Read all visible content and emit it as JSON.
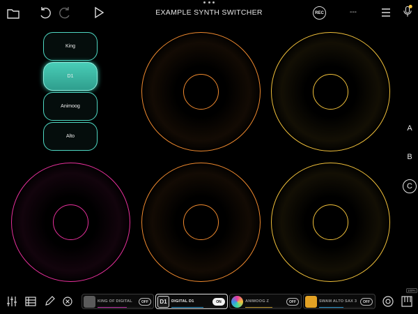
{
  "header": {
    "title": "EXAMPLE SYNTH SWITCHER",
    "rec_label": "REC",
    "status_text": "---",
    "icons": [
      "folder-icon",
      "undo-icon",
      "redo-icon",
      "play-icon",
      "menu-icon",
      "microphone-icon"
    ]
  },
  "presets": [
    {
      "label": "King",
      "active": false
    },
    {
      "label": "D1",
      "active": true
    },
    {
      "label": "Animoog",
      "active": false
    },
    {
      "label": "Alto",
      "active": false
    }
  ],
  "scenes": [
    {
      "label": "A",
      "selected": false
    },
    {
      "label": "B",
      "selected": false
    },
    {
      "label": "C",
      "selected": true
    }
  ],
  "pads": [
    {
      "name": "pad-top-middle",
      "color": "#f08a2e"
    },
    {
      "name": "pad-top-right",
      "color": "#f2c13a"
    },
    {
      "name": "pad-bottom-left",
      "color": "#e8309c"
    },
    {
      "name": "pad-bottom-middle",
      "color": "#f08a2e"
    },
    {
      "name": "pad-bottom-right",
      "color": "#f2c13a"
    }
  ],
  "synth_slots": [
    {
      "name": "KING OF DIGITAL",
      "toggle": "OFF",
      "active": false,
      "thumb": "#5a5a5a",
      "meter_color": "#c63bb0",
      "level": 0.55
    },
    {
      "name": "DIGITAL D1",
      "toggle": "ON",
      "active": true,
      "thumb": "#1a1a1a",
      "meter_color": "#3aa3d9",
      "level": 0.6
    },
    {
      "name": "ANIMOOG Z",
      "toggle": "OFF",
      "active": false,
      "thumb": "#2a2a2a",
      "meter_color": "#c8a23a",
      "level": 0.5
    },
    {
      "name": "SWAM ALTO SAX 3",
      "toggle": "OFF",
      "active": false,
      "thumb": "#e3a224",
      "meter_color": "#3aa3d9",
      "level": 0.45
    }
  ],
  "bottom_icons": [
    "mixer-icon",
    "list-icon",
    "pen-icon",
    "close-circle-icon",
    "record-circle-icon",
    "keyboard-icon"
  ],
  "zoom_badge": "100%",
  "colors": {
    "accent_teal": "#49cdb7",
    "orange": "#f08a2e",
    "yellow": "#f2c13a",
    "magenta": "#e8309c"
  }
}
